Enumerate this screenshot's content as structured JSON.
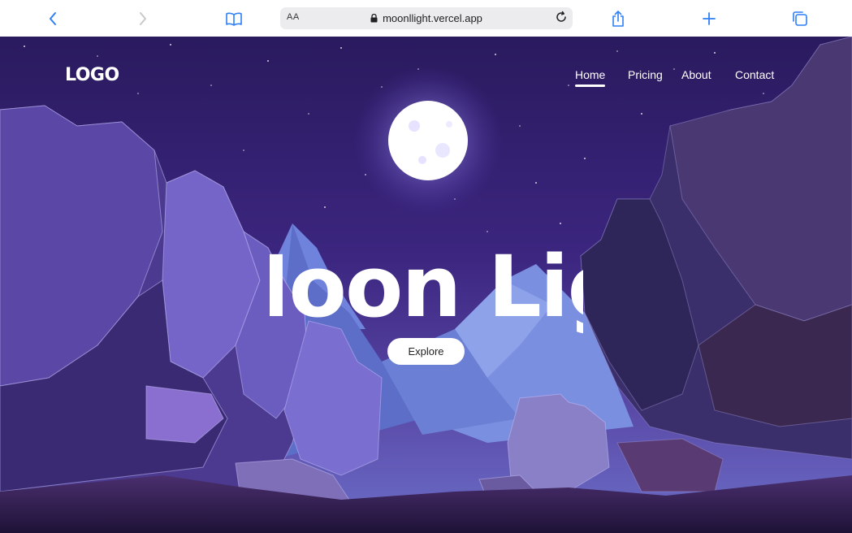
{
  "browser": {
    "address_bar": {
      "text_size_label": "AA",
      "url": "moonllight.vercel.app"
    },
    "icons": [
      "back-icon",
      "forward-icon",
      "bookmarks-icon",
      "lock-icon",
      "reload-icon",
      "share-icon",
      "new-tab-icon",
      "tabs-icon"
    ]
  },
  "site": {
    "logo": "LOGO",
    "nav": {
      "items": [
        "Home",
        "Pricing",
        "About",
        "Contact"
      ],
      "active": "Home"
    },
    "hero": {
      "title": "Moon Light",
      "cta_label": "Explore"
    }
  },
  "colors": {
    "sky_top": "#2a1a5e",
    "sky_mid": "#4a2f8a",
    "moon": "#ffffff",
    "mountain": "#7b8fe0",
    "cliff_left": "#6a58b8",
    "cliff_right": "#2e2552",
    "toolbar_icon": "#2f7ff5"
  }
}
